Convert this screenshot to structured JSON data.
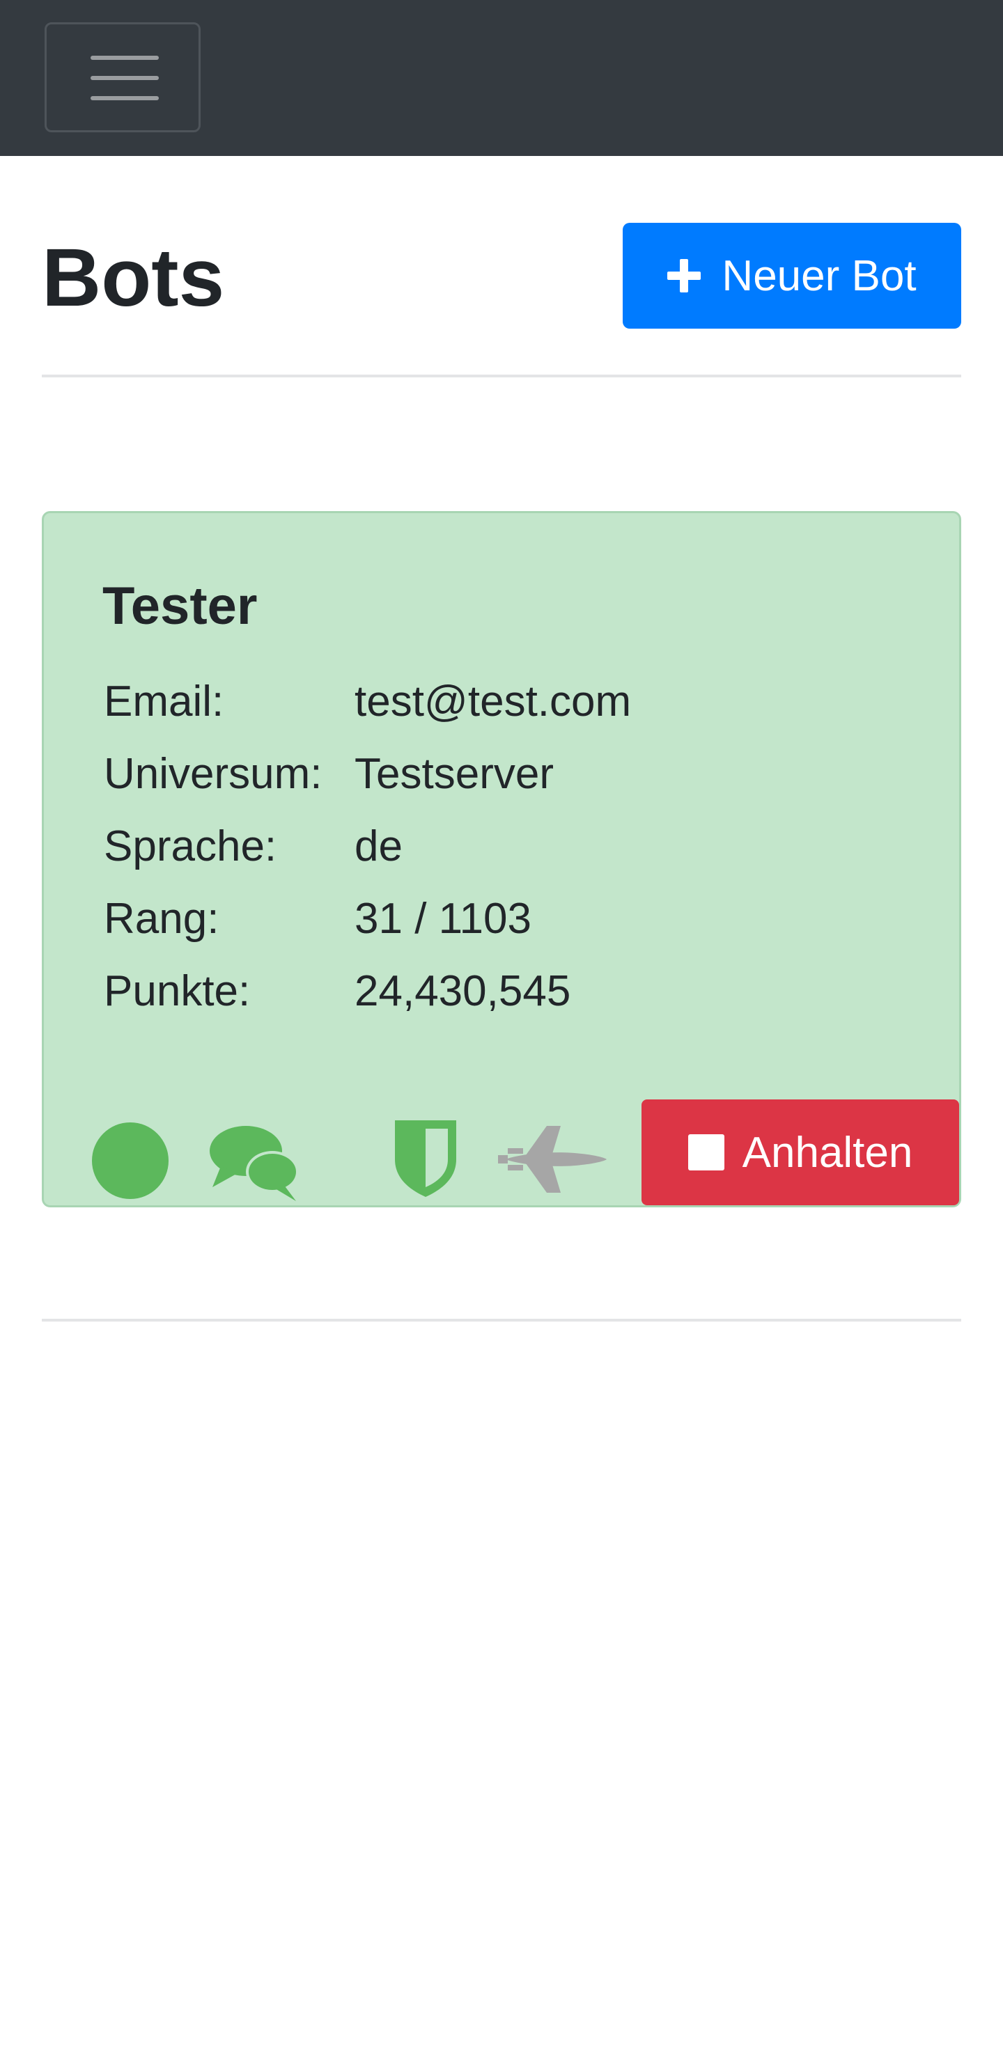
{
  "navbar": {
    "menu_icon": "hamburger-menu-icon"
  },
  "header": {
    "title": "Bots",
    "new_bot_label": "Neuer Bot",
    "new_bot_icon": "plus-icon",
    "new_bot_color": "#007bff"
  },
  "bot_card": {
    "name": "Tester",
    "background_color": "#c3e6cb",
    "fields": [
      {
        "label": "Email:",
        "value": "test@test.com"
      },
      {
        "label": "Universum:",
        "value": "Testserver"
      },
      {
        "label": "Sprache:",
        "value": "de"
      },
      {
        "label": "Rang:",
        "value": "31 / 1103"
      },
      {
        "label": "Punkte:",
        "value": "24,430,545"
      }
    ],
    "status_icons": [
      {
        "name": "status-dot-icon",
        "color": "#5cb85c"
      },
      {
        "name": "chat-bubbles-icon",
        "color": "#5cb85c"
      },
      {
        "name": "shield-icon",
        "color": "#5cb85c"
      },
      {
        "name": "space-shuttle-icon",
        "color": "#a6a6a6"
      }
    ],
    "stop_label": "Anhalten",
    "stop_icon": "stop-icon",
    "stop_color": "#dc3545"
  }
}
